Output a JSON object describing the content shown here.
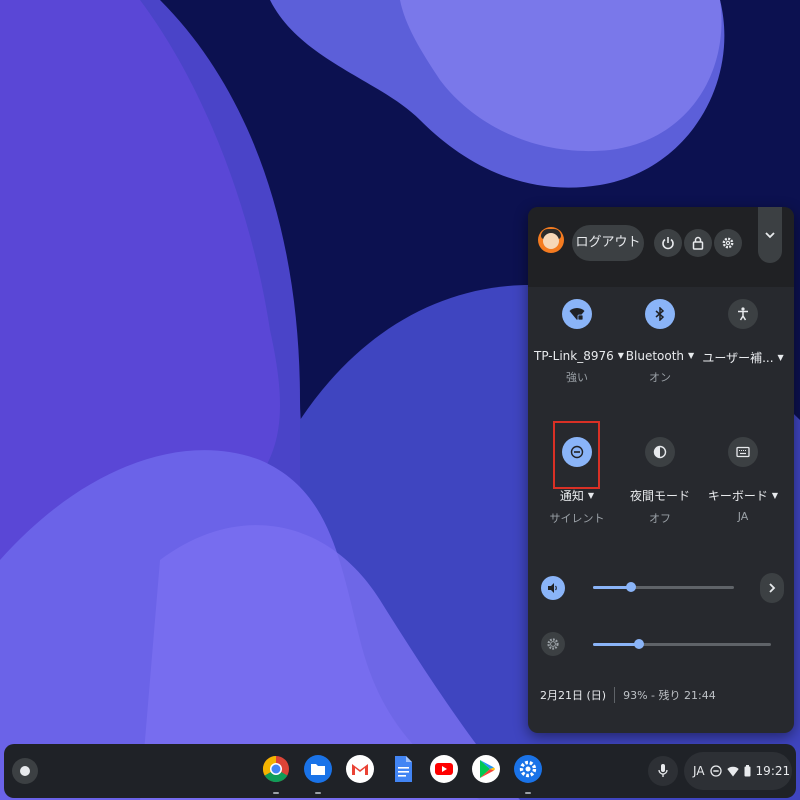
{
  "quick_settings": {
    "logout_label": "ログアウト",
    "tiles": [
      {
        "label": "TP-Link_8976",
        "sub": "強い",
        "icon": "wifi-icon",
        "state": "on"
      },
      {
        "label": "Bluetooth",
        "sub": "オン",
        "icon": "bluetooth-icon",
        "state": "on"
      },
      {
        "label": "ユーザー補...",
        "sub": "",
        "icon": "accessibility-icon",
        "state": "off"
      },
      {
        "label": "通知",
        "sub": "サイレント",
        "icon": "do-not-disturb-icon",
        "state": "on"
      },
      {
        "label": "夜間モード",
        "sub": "オフ",
        "icon": "night-light-icon",
        "state": "off"
      },
      {
        "label": "キーボード",
        "sub": "JA",
        "icon": "keyboard-icon",
        "state": "off"
      }
    ],
    "volume_level": 0.27,
    "brightness_level": 0.26,
    "date": "2月21日 (日)",
    "battery": "93% - 残り 21:44"
  },
  "shelf": {
    "apps": [
      "chrome-icon",
      "files-icon",
      "gmail-icon",
      "docs-icon",
      "youtube-icon",
      "play-store-icon",
      "settings-icon"
    ],
    "ime": "JA",
    "time": "19:21"
  },
  "colors": {
    "accent": "#8ab4f8",
    "panel": "#27292e",
    "highlight": "#d93025"
  }
}
